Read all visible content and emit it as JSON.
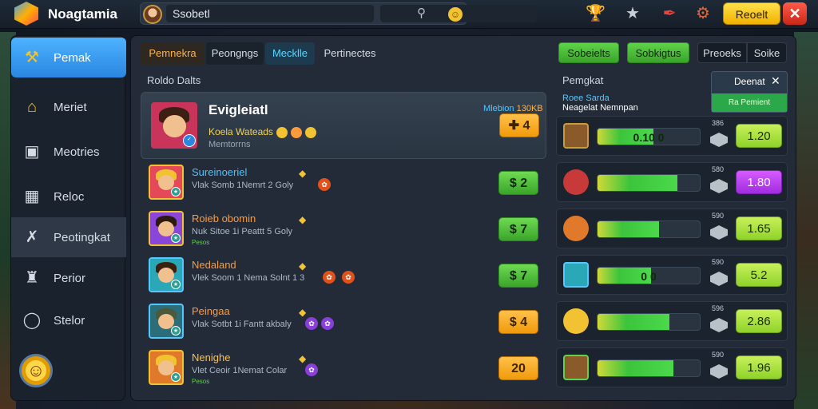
{
  "app": {
    "title": "Noagtamia"
  },
  "search": {
    "value": "Ssobetl",
    "placeholder": ""
  },
  "top_actions": {
    "reset_label": "Reoelt",
    "close_label": "✕",
    "icons": [
      "trophy-icon",
      "star-icon",
      "feather-icon",
      "settings-icon"
    ]
  },
  "sidebar": {
    "items": [
      {
        "label": "Pemak",
        "icon": "hammer-icon",
        "active": true
      },
      {
        "label": "Meriet",
        "icon": "home-icon"
      },
      {
        "label": "Meotries",
        "icon": "chest-icon"
      },
      {
        "label": "Reloc",
        "icon": "building-icon"
      },
      {
        "label": "Peotingkat",
        "icon": "tools-icon",
        "selected": true
      },
      {
        "label": "Perior",
        "icon": "castle-icon"
      },
      {
        "label": "Stelor",
        "icon": "chat-icon"
      }
    ],
    "profile_icon": "smiley-icon"
  },
  "tabs": [
    {
      "label": "Pemnekra"
    },
    {
      "label": "Peongngs"
    },
    {
      "label": "Mecklle"
    },
    {
      "label": "Pertinectes"
    }
  ],
  "action_buttons": {
    "green1": "Sobeielts",
    "green2": "Sobkigtus",
    "dark1": "Preoeks",
    "dark2": "Soike"
  },
  "left_section": {
    "title": "Roldo Dalts"
  },
  "featured": {
    "name": "Evigleiatl",
    "tag": "Mlebion",
    "tag_value": "130KB",
    "sub": "Koela Wateads",
    "sub2": "Memtorrns",
    "score": "4"
  },
  "players": [
    {
      "name": "Sureinoeriel",
      "name_color": "#4fc3ff",
      "sub": "Vlak Somb 1Nemrt 2 Goly",
      "score": "2",
      "pill": "green"
    },
    {
      "name": "Roieb obomin",
      "name_color": "#ff9a3c",
      "sub": "Nuk Sitoe 1i Peattt 5 Goly",
      "tiny": "Pesos",
      "score": "7",
      "pill": "green"
    },
    {
      "name": "Nedaland",
      "name_color": "#ff9a3c",
      "sub": "Vlek Soom 1 Nema Solnt 1 3",
      "score": "7",
      "pill": "green"
    },
    {
      "name": "Peingaa",
      "name_color": "#ff9a3c",
      "sub": "Vlak Sotbt 1i Fantt akbaly",
      "score": "4",
      "pill": "orange"
    },
    {
      "name": "Nenighe",
      "name_color": "#ffc14a",
      "sub": "Vlet Ceoir 1Nemat Colar",
      "tiny": "Pesos",
      "score": "20",
      "pill": "orange"
    }
  ],
  "right_panel": {
    "title": "Pemgkat",
    "info_line1": "Roee Sarda",
    "info_line2": "Neagelat Nemnpan",
    "dismiss_title": "Deenat",
    "dismiss_sub": "Ra Pemient"
  },
  "upgrades": [
    {
      "bar_label": "0.10 0",
      "level": 0.55,
      "tiny": "386",
      "value": "1.20",
      "pill": "green"
    },
    {
      "bar_label": "",
      "level": 0.78,
      "tiny": "580",
      "value": "1.80",
      "pill": "purple"
    },
    {
      "bar_label": "",
      "level": 0.6,
      "tiny": "590",
      "value": "1.65",
      "pill": "green"
    },
    {
      "bar_label": "0 0",
      "level": 0.52,
      "tiny": "590",
      "value": "5.2",
      "pill": "green"
    },
    {
      "bar_label": "",
      "level": 0.7,
      "tiny": "596",
      "value": "2.86",
      "pill": "green"
    },
    {
      "bar_label": "",
      "level": 0.74,
      "tiny": "590",
      "value": "1.96",
      "pill": "green"
    }
  ],
  "colors": {
    "accent": "#2a86e0",
    "green": "#3aa42a",
    "orange": "#f09a0c",
    "purple": "#a12ce0"
  }
}
